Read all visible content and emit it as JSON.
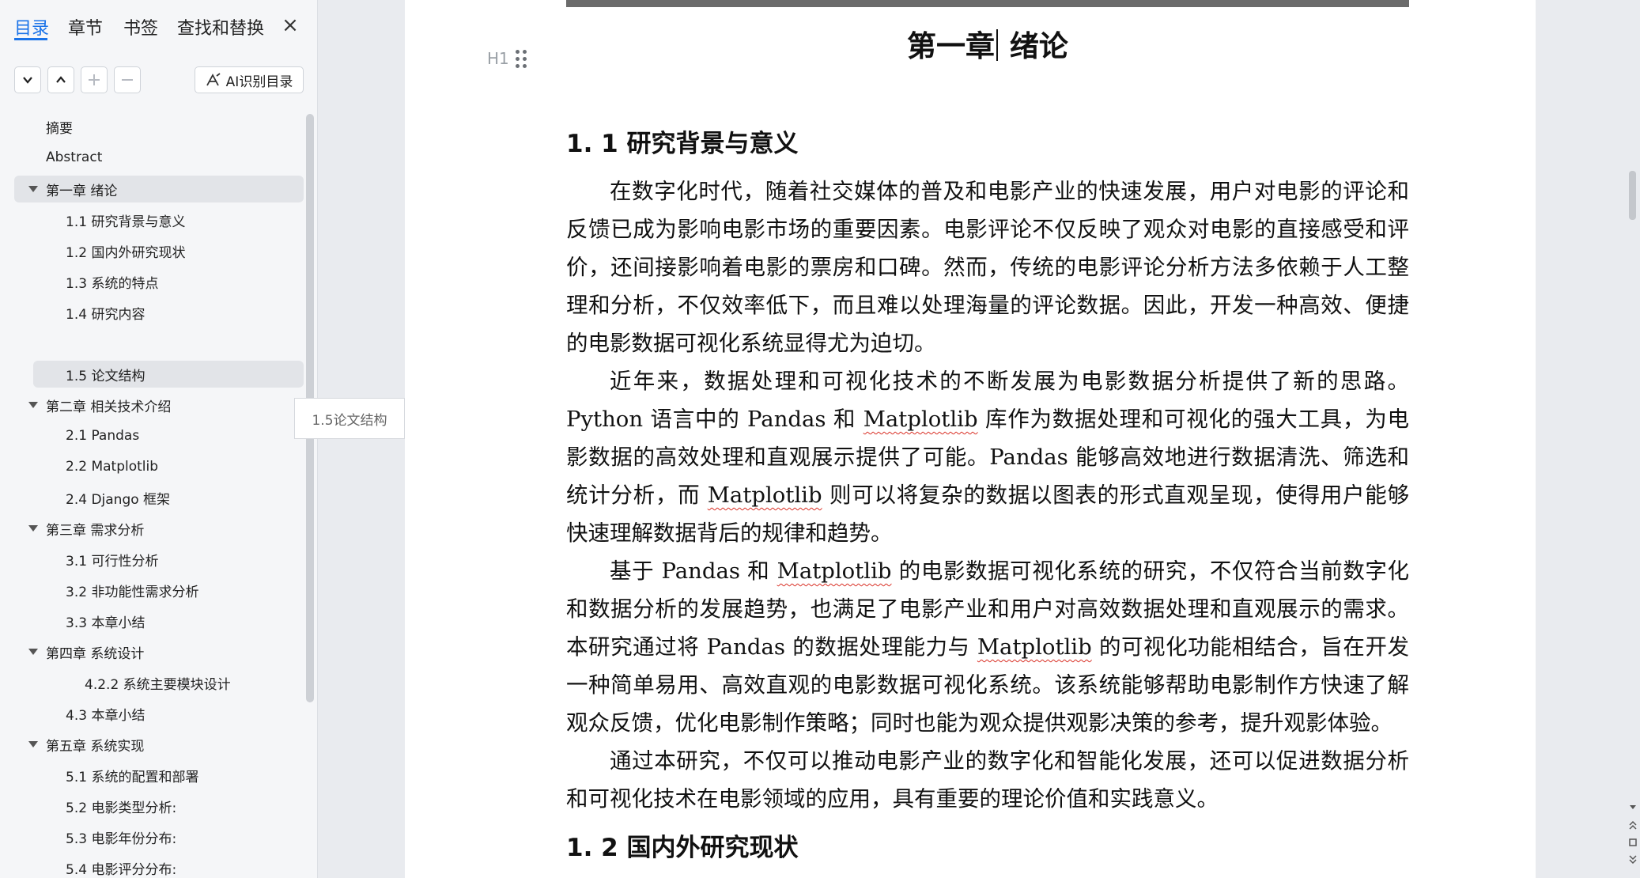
{
  "sidebar": {
    "tabs": [
      "目录",
      "章节",
      "书签",
      "查找和替换"
    ],
    "close": "×",
    "toolbar": {
      "ai_label": "AI识别目录"
    },
    "toc": [
      {
        "label": "摘要"
      },
      {
        "label": "Abstract"
      },
      {
        "label": "第一章  绪论"
      },
      {
        "label": "1.1 研究背景与意义"
      },
      {
        "label": "1.2 国内外研究现状"
      },
      {
        "label": "1.3 系统的特点"
      },
      {
        "label": "1.4 研究内容"
      },
      {
        "label": "1.5 论文结构"
      },
      {
        "label": "第二章  相关技术介绍"
      },
      {
        "label": "2.1 Pandas"
      },
      {
        "label": "2.2 Matplotlib"
      },
      {
        "label": "2.4 Django 框架"
      },
      {
        "label": "第三章  需求分析"
      },
      {
        "label": "3.1 可行性分析"
      },
      {
        "label": "3.2  非功能性需求分析"
      },
      {
        "label": "3.3 本章小结"
      },
      {
        "label": "第四章  系统设计"
      },
      {
        "label": "4.2.2 系统主要模块设计"
      },
      {
        "label": "4.3  本章小结"
      },
      {
        "label": "第五章  系统实现"
      },
      {
        "label": "5.1  系统的配置和部署"
      },
      {
        "label": "5.2 电影类型分析:"
      },
      {
        "label": "5.3 电影年份分布:"
      },
      {
        "label": "5.4 电影评分分布:"
      }
    ],
    "tooltip": "1.5论文结构"
  },
  "document": {
    "gutter_label": "H1",
    "chapter_title_a": "第一章",
    "chapter_title_b": " 绪论",
    "section1_title": "1. 1 研究背景与意义",
    "p1": "在数字化时代，随着社交媒体的普及和电影产业的快速发展，用户对电影的评论和反馈已成为影响电影市场的重要因素。电影评论不仅反映了观众对电影的直接感受和评价，还间接影响着电影的票房和口碑。然而，传统的电影评论分析方法多依赖于人工整理和分析，不仅效率低下，而且难以处理海量的评论数据。因此，开发一种高效、便捷的电影数据可视化系统显得尤为迫切。",
    "p2a": "近年来，数据处理和可视化技术的不断发展为电影数据分析提供了新的思路。Python 语言中的 Pandas 和 ",
    "p2b": "Matplotlib",
    "p2c": " 库作为数据处理和可视化的强大工具，为电影数据的高效处理和直观展示提供了可能。Pandas 能够高效地进行数据清洗、筛选和统计分析，而 ",
    "p2d": "Matplotlib",
    "p2e": " 则可以将复杂的数据以图表的形式直观呈现，使得用户能够快速理解数据背后的规律和趋势。",
    "p3a": "基于 Pandas 和 ",
    "p3b": "Matplotlib",
    "p3c": " 的电影数据可视化系统的研究，不仅符合当前数字化和数据分析的发展趋势，也满足了电影产业和用户对高效数据处理和直观展示的需求。本研究通过将 Pandas 的数据处理能力与 ",
    "p3d": "Matplotlib",
    "p3e": " 的可视化功能相结合，旨在开发一种简单易用、高效直观的电影数据可视化系统。该系统能够帮助电影制作方快速了解观众反馈，优化电影制作策略；同时也能为观众提供观影决策的参考，提升观影体验。",
    "p4": "通过本研究，不仅可以推动电影产业的数字化和智能化发展，还可以促进数据分析和可视化技术在电影领域的应用，具有重要的理论价值和实践意义。",
    "section2_title": "1. 2 国内外研究现状"
  }
}
